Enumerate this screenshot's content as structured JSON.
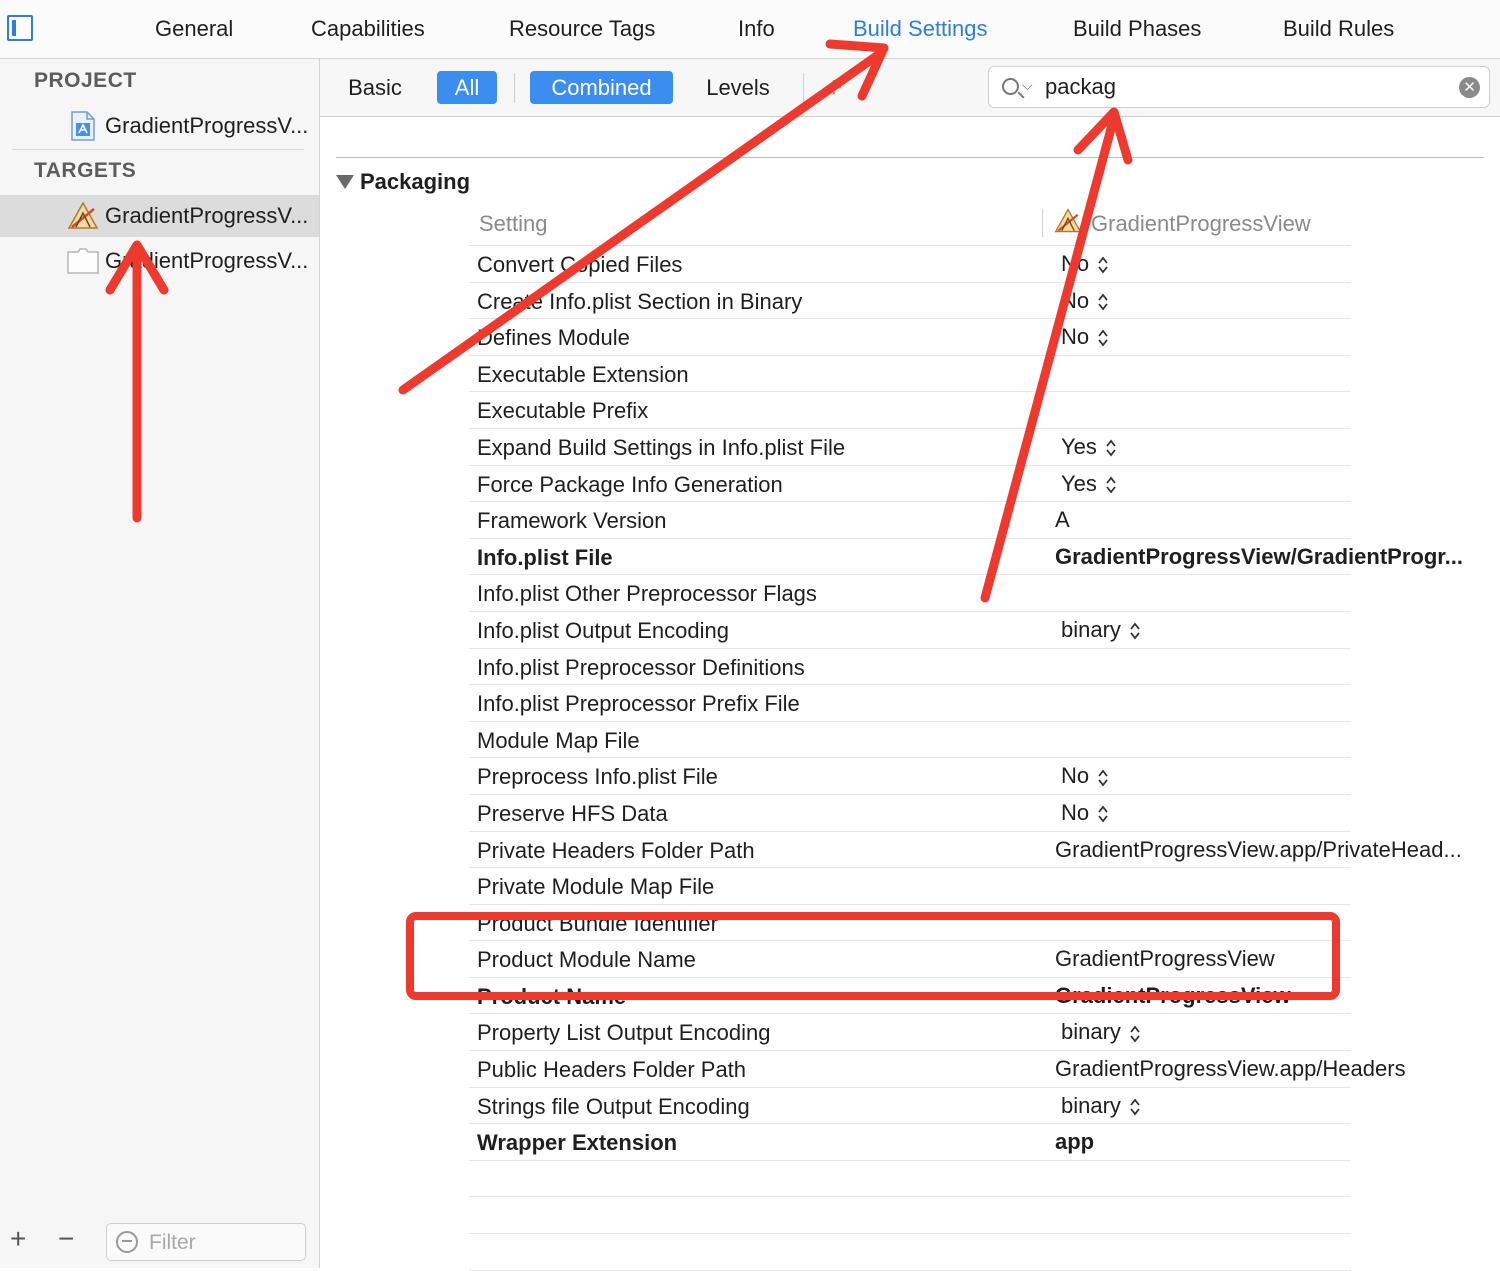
{
  "tabs": [
    {
      "label": "General",
      "active": false
    },
    {
      "label": "Capabilities",
      "active": false
    },
    {
      "label": "Resource Tags",
      "active": false
    },
    {
      "label": "Info",
      "active": false
    },
    {
      "label": "Build Settings",
      "active": true
    },
    {
      "label": "Build Phases",
      "active": false
    },
    {
      "label": "Build Rules",
      "active": false
    }
  ],
  "sidebar": {
    "project_header": "PROJECT",
    "project_item": "GradientProgressV...",
    "targets_header": "TARGETS",
    "targets": [
      {
        "label": "GradientProgressV...",
        "icon": "app-target-icon",
        "selected": true
      },
      {
        "label": "GradientProgressV...",
        "icon": "bundle-target-icon",
        "selected": false
      }
    ],
    "add_button": "+",
    "remove_button": "−",
    "filter_placeholder": "Filter"
  },
  "toolbar": {
    "basic": "Basic",
    "all": "All",
    "combined": "Combined",
    "levels": "Levels",
    "add": "+",
    "search_value": "packag"
  },
  "section": {
    "title": "Packaging",
    "col_setting": "Setting",
    "col_target": "GradientProgressView"
  },
  "settings": [
    {
      "name": "Convert Copied Files",
      "value": "No",
      "stepper": true,
      "bold": false
    },
    {
      "name": "Create Info.plist Section in Binary",
      "value": "No",
      "stepper": true,
      "bold": false
    },
    {
      "name": "Defines Module",
      "value": "No",
      "stepper": true,
      "bold": false
    },
    {
      "name": "Executable Extension",
      "value": "",
      "stepper": false,
      "bold": false
    },
    {
      "name": "Executable Prefix",
      "value": "",
      "stepper": false,
      "bold": false
    },
    {
      "name": "Expand Build Settings in Info.plist File",
      "value": "Yes",
      "stepper": true,
      "bold": false
    },
    {
      "name": "Force Package Info Generation",
      "value": "Yes",
      "stepper": true,
      "bold": false
    },
    {
      "name": "Framework Version",
      "value": "A",
      "stepper": false,
      "bold": false
    },
    {
      "name": "Info.plist File",
      "value": "GradientProgressView/GradientProgr...",
      "stepper": false,
      "bold": true
    },
    {
      "name": "Info.plist Other Preprocessor Flags",
      "value": "",
      "stepper": false,
      "bold": false
    },
    {
      "name": "Info.plist Output Encoding",
      "value": "binary",
      "stepper": true,
      "bold": false
    },
    {
      "name": "Info.plist Preprocessor Definitions",
      "value": "",
      "stepper": false,
      "bold": false
    },
    {
      "name": "Info.plist Preprocessor Prefix File",
      "value": "",
      "stepper": false,
      "bold": false
    },
    {
      "name": "Module Map File",
      "value": "",
      "stepper": false,
      "bold": false
    },
    {
      "name": "Preprocess Info.plist File",
      "value": "No",
      "stepper": true,
      "bold": false
    },
    {
      "name": "Preserve HFS Data",
      "value": "No",
      "stepper": true,
      "bold": false
    },
    {
      "name": "Private Headers Folder Path",
      "value": "GradientProgressView.app/PrivateHead...",
      "stepper": false,
      "bold": false
    },
    {
      "name": "Private Module Map File",
      "value": "",
      "stepper": false,
      "bold": false
    },
    {
      "name": "Product Bundle Identifier",
      "value": "",
      "stepper": false,
      "bold": false
    },
    {
      "name": "Product Module Name",
      "value": "GradientProgressView",
      "stepper": false,
      "bold": false
    },
    {
      "name": "Product Name",
      "value": "GradientProgressView",
      "stepper": false,
      "bold": true
    },
    {
      "name": "Property List Output Encoding",
      "value": "binary",
      "stepper": true,
      "bold": false
    },
    {
      "name": "Public Headers Folder Path",
      "value": "GradientProgressView.app/Headers",
      "stepper": false,
      "bold": false
    },
    {
      "name": "Strings file Output Encoding",
      "value": "binary",
      "stepper": true,
      "bold": false
    },
    {
      "name": "Wrapper Extension",
      "value": "app",
      "stepper": false,
      "bold": true
    }
  ],
  "colors": {
    "accent": "#2f7de1",
    "annotation": "#ee3a2e"
  }
}
